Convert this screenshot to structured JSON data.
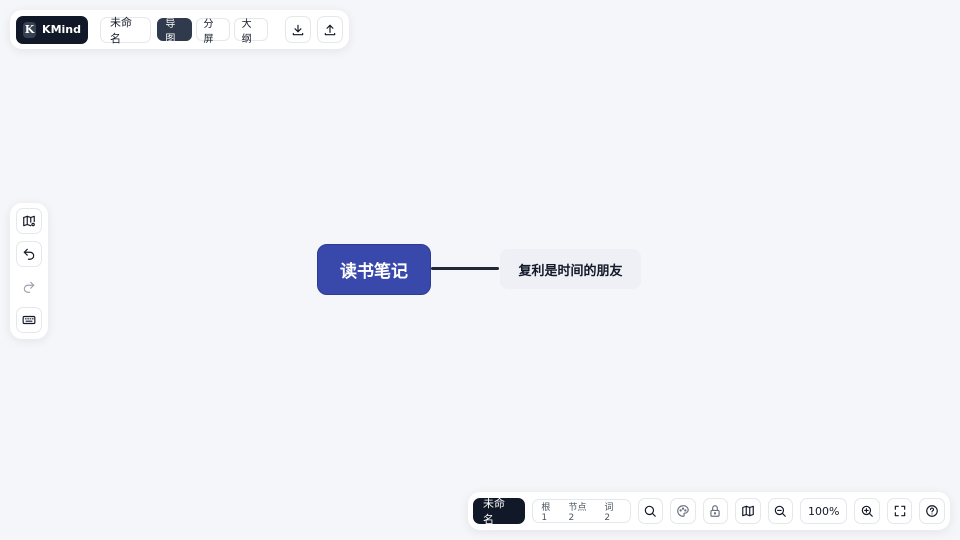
{
  "app": {
    "brand_logo": "K",
    "brand_name": "KMind"
  },
  "top_bar": {
    "document_title": "未命名",
    "view_tabs": [
      {
        "label": "导图",
        "active": true
      },
      {
        "label": "分屏",
        "active": false
      },
      {
        "label": "大纲",
        "active": false
      }
    ],
    "icons": {
      "download": "download-icon",
      "upload": "upload-icon"
    }
  },
  "left_bar": {
    "icons": [
      "map-settings-icon",
      "undo-icon",
      "redo-icon",
      "keyboard-icon"
    ],
    "redo_disabled": true
  },
  "mindmap": {
    "root": "读书笔记",
    "children": [
      "复利是时间的朋友"
    ],
    "colors": {
      "root_fill": "#3949ab",
      "child_fill": "#eef0f5",
      "connector": "#1f2937"
    }
  },
  "bottom_bar": {
    "document_title": "未命名",
    "stats": {
      "root": "根 1",
      "nodes": "节点 2",
      "words": "词 2"
    },
    "zoom": "100%",
    "icons": [
      "search-icon",
      "palette-icon",
      "lock-icon",
      "map-icon",
      "zoom-out-icon",
      "zoom-in-icon",
      "fullscreen-icon",
      "help-icon"
    ]
  }
}
